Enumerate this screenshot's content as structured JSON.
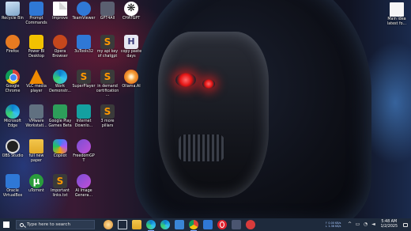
{
  "desktop": {
    "icons": [
      {
        "id": "recycle",
        "label": "Recycle Bin",
        "icon": "recycle-bin-icon"
      },
      {
        "id": "prompt",
        "label": "Prompt Commands",
        "icon": "document-icon"
      },
      {
        "id": "improve",
        "label": "Improve",
        "icon": "document-icon"
      },
      {
        "id": "teamviewer",
        "label": "TeamViewer",
        "icon": "teamviewer-icon"
      },
      {
        "id": "gpt",
        "label": "GPT4All",
        "icon": "gpt4all-icon"
      },
      {
        "id": "chatgpt",
        "label": "CHATGPT",
        "icon": "chatgpt-icon"
      },
      {
        "id": "firefox",
        "label": "Firefox",
        "icon": "firefox-icon"
      },
      {
        "id": "powerbi",
        "label": "Power BI Desktop",
        "icon": "power-bi-icon"
      },
      {
        "id": "opera",
        "label": "Opera Browser",
        "icon": "opera-icon"
      },
      {
        "id": "tomp3",
        "label": "3uTools32",
        "icon": "3utools-icon"
      },
      {
        "id": "apikey",
        "label": "my api key of chatgpt",
        "icon": "sublime-icon"
      },
      {
        "id": "copypaste",
        "label": "copy paste days",
        "icon": "h-icon"
      },
      {
        "id": "chrome",
        "label": "Google Chrome",
        "icon": "chrome-icon"
      },
      {
        "id": "vlc",
        "label": "VLC media player",
        "icon": "vlc-icon"
      },
      {
        "id": "work",
        "label": "Work Demonstr...",
        "icon": "work-icon"
      },
      {
        "id": "potplayer",
        "label": "SuperPlayer",
        "icon": "potplayer-icon"
      },
      {
        "id": "indemand",
        "label": "in demand certification...",
        "icon": "sublime-icon"
      },
      {
        "id": "ollama",
        "label": "Ollama.AI",
        "icon": "swirl-icon"
      },
      {
        "id": "edge",
        "label": "Microsoft Edge",
        "icon": "edge-icon"
      },
      {
        "id": "vmware",
        "label": "VMware Workstati...",
        "icon": "vmware-icon"
      },
      {
        "id": "googleplay",
        "label": "Google Play Games Beta",
        "icon": "google-play-icon"
      },
      {
        "id": "internet",
        "label": "Internet Downlo...",
        "icon": "internet-download-icon"
      },
      {
        "id": "pillars",
        "label": "3 more pillars",
        "icon": "sublime-icon"
      },
      {
        "id": "obs",
        "label": "OBS Studio",
        "icon": "obs-icon"
      },
      {
        "id": "fullnew",
        "label": "full new paper",
        "icon": "paper-icon"
      },
      {
        "id": "copilot",
        "label": "Copilot",
        "icon": "copilot-icon"
      },
      {
        "id": "freedomgpt",
        "label": "FreedomGPT",
        "icon": "freedomgpt-icon"
      },
      {
        "id": "oracle",
        "label": "Oracle VirtualBox",
        "icon": "virtualbox-icon"
      },
      {
        "id": "utorrent",
        "label": "uTorrent",
        "icon": "utorrent-icon"
      },
      {
        "id": "important",
        "label": "Important links.txt",
        "icon": "sublime-icon"
      },
      {
        "id": "aiimage",
        "label": "AI Image Genera...",
        "icon": "ai-image-icon"
      }
    ],
    "main_idea": {
      "label": "Main idea latest fo...",
      "icon": "document-icon"
    }
  },
  "taskbar": {
    "search_placeholder": "Type here to search",
    "apps": [
      "cortana-icon",
      "task-view-icon",
      "file-explorer-icon",
      "edge-icon",
      "edge-icon",
      "store-icon",
      "chrome-icon",
      "mail-icon",
      "opera-icon",
      "notes-icon",
      "spotify-icon"
    ],
    "network": {
      "upload": "↑ 0.00 KB/s",
      "download": "↓ 1.38 KB/s"
    },
    "time": "5:48 AM",
    "date": "1/2/2025"
  },
  "colors": {
    "taskbar": "#1e2a3c",
    "eye": "#e41414"
  }
}
